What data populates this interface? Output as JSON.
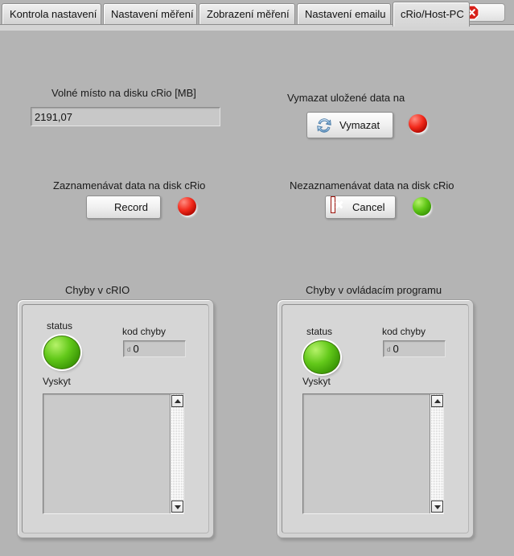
{
  "window": {
    "background_color": "#b4b4b4",
    "close_button": {
      "name": "close",
      "icon": "close-octagon-icon",
      "label": ""
    }
  },
  "tabs": [
    {
      "label": "Kontrola nastavení",
      "active": false
    },
    {
      "label": "Nastavení měření",
      "active": false
    },
    {
      "label": "Zobrazení měření",
      "active": false
    },
    {
      "label": "Nastavení emailu",
      "active": false
    },
    {
      "label": "cRio/Host-PC",
      "active": true
    }
  ],
  "disk": {
    "label": "Volné místo na disku cRio [MB]",
    "value": "2191,07"
  },
  "erase": {
    "label": "Vymazat uložené data na",
    "button_label": "Vymazat",
    "button_icon": "refresh-sync-icon",
    "led": {
      "name": "erase-led",
      "color": "#ee1b10",
      "state": "off"
    }
  },
  "record": {
    "label": "Zaznamenávat data na disk cRio",
    "button_label": "Record",
    "button_icon": "record-dot-icon",
    "led": {
      "name": "record-led",
      "color": "#ee1b10",
      "state": "off"
    }
  },
  "cancel": {
    "label": "Nezaznamenávat data na disk cRio",
    "button_label": "Cancel",
    "button_icon": "cancel-x-icon",
    "led": {
      "name": "cancel-led",
      "color": "#63c91a",
      "state": "on"
    }
  },
  "error_clusters": [
    {
      "title": "Chyby v cRIO",
      "status_label": "status",
      "status_led": {
        "color": "#63c91a",
        "state": "on"
      },
      "code_label": "kod chyby",
      "code_radix": "d",
      "code_value": "0",
      "source_label": "Vyskyt",
      "source_value": ""
    },
    {
      "title": "Chyby v ovládacím programu",
      "status_label": "status",
      "status_led": {
        "color": "#63c91a",
        "state": "on"
      },
      "code_label": "kod chyby",
      "code_radix": "d",
      "code_value": "0",
      "source_label": "Vyskyt",
      "source_value": ""
    }
  ]
}
